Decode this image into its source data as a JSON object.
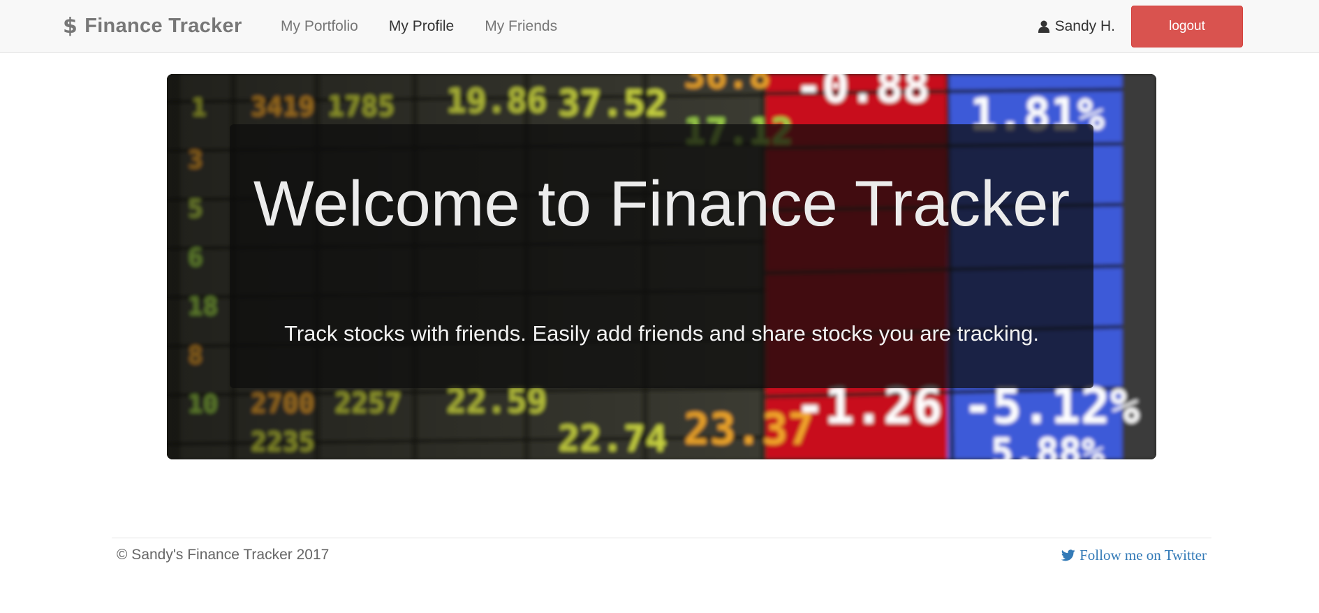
{
  "navbar": {
    "brand_icon": "dollar-icon",
    "brand_symbol": "$",
    "brand_name": "Finance Tracker",
    "links": [
      {
        "label": "My Portfolio",
        "active": false
      },
      {
        "label": "My Profile",
        "active": true
      },
      {
        "label": "My Friends",
        "active": false
      }
    ],
    "user": {
      "icon": "user-icon",
      "name": "Sandy H."
    },
    "logout_label": "logout"
  },
  "hero": {
    "title": "Welcome to Finance Tracker",
    "subtitle": "Track stocks with friends. Easily add friends and share stocks you are tracking.",
    "background": "stock-ticker-board-image"
  },
  "footer": {
    "copyright": "© Sandy's Finance Tracker 2017",
    "twitter_icon": "twitter-icon",
    "twitter_label": "Follow me on Twitter"
  },
  "colors": {
    "navbar_bg": "#f8f8f8",
    "logout_bg": "#d9534f",
    "link_blue": "#337ab7",
    "hero_overlay": "#0c0c0c"
  }
}
